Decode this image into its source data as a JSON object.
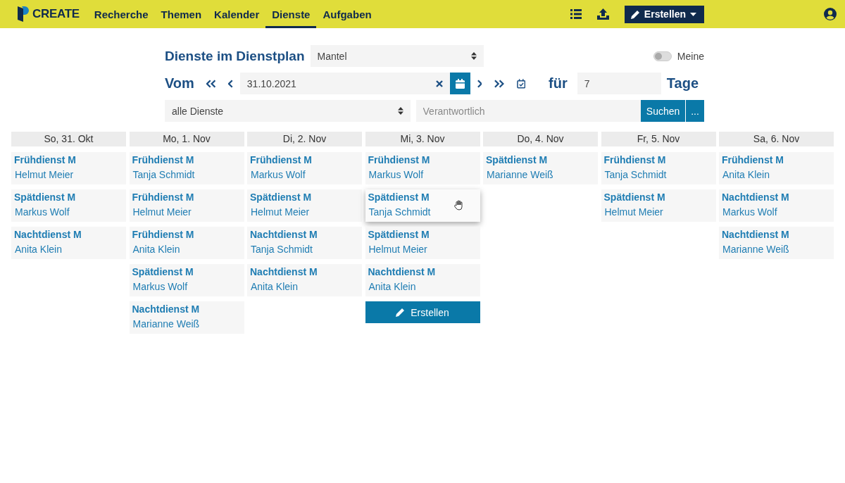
{
  "brand": "CREATE",
  "nav": [
    {
      "label": "Recherche",
      "selected": false
    },
    {
      "label": "Themen",
      "selected": false
    },
    {
      "label": "Kalender",
      "selected": false
    },
    {
      "label": "Dienste",
      "selected": true
    },
    {
      "label": "Aufgaben",
      "selected": false
    }
  ],
  "create_menu": "Erstellen",
  "filter": {
    "title": "Dienste im Dienstplan",
    "plan": "Mantel",
    "mine_label": "Meine",
    "mine_on": false,
    "from_label": "Vom",
    "date": "31.10.2021",
    "for_label": "für",
    "days": "7",
    "days_label": "Tage",
    "service": "alle Dienste",
    "responsible_placeholder": "Verantwortlich",
    "search": "Suchen",
    "more": "..."
  },
  "days": [
    {
      "header": "So, 31. Okt",
      "shifts": [
        {
          "name": "Frühdienst M",
          "person": "Helmut Meier",
          "hovered": false
        },
        {
          "name": "Spätdienst M",
          "person": "Markus Wolf",
          "hovered": false
        },
        {
          "name": "Nachtdienst M",
          "person": "Anita Klein",
          "hovered": false
        }
      ]
    },
    {
      "header": "Mo, 1. Nov",
      "shifts": [
        {
          "name": "Frühdienst M",
          "person": "Tanja Schmidt",
          "hovered": false
        },
        {
          "name": "Frühdienst M",
          "person": "Helmut Meier",
          "hovered": false
        },
        {
          "name": "Frühdienst M",
          "person": "Anita Klein",
          "hovered": false
        },
        {
          "name": "Spätdienst M",
          "person": "Markus Wolf",
          "hovered": false
        },
        {
          "name": "Nachtdienst M",
          "person": "Marianne Weiß",
          "hovered": false
        }
      ]
    },
    {
      "header": "Di, 2. Nov",
      "shifts": [
        {
          "name": "Frühdienst M",
          "person": "Markus Wolf",
          "hovered": false
        },
        {
          "name": "Spätdienst M",
          "person": "Helmut Meier",
          "hovered": false
        },
        {
          "name": "Nachtdienst M",
          "person": "Tanja Schmidt",
          "hovered": false
        },
        {
          "name": "Nachtdienst M",
          "person": "Anita Klein",
          "hovered": false
        }
      ]
    },
    {
      "header": "Mi, 3. Nov",
      "shifts": [
        {
          "name": "Frühdienst M",
          "person": "Markus Wolf",
          "hovered": false
        },
        {
          "name": "Spätdienst M",
          "person": "Tanja Schmidt",
          "hovered": true
        },
        {
          "name": "Spätdienst M",
          "person": "Helmut Meier",
          "hovered": false
        },
        {
          "name": "Nachtdienst M",
          "person": "Anita Klein",
          "hovered": false
        }
      ],
      "create_label": "Erstellen"
    },
    {
      "header": "Do, 4. Nov",
      "shifts": [
        {
          "name": "Spätdienst M",
          "person": "Marianne Weiß",
          "hovered": false
        }
      ]
    },
    {
      "header": "Fr, 5. Nov",
      "shifts": [
        {
          "name": "Frühdienst M",
          "person": "Tanja Schmidt",
          "hovered": false
        },
        {
          "name": "Spätdienst M",
          "person": "Helmut Meier",
          "hovered": false
        }
      ]
    },
    {
      "header": "Sa, 6. Nov",
      "shifts": [
        {
          "name": "Frühdienst M",
          "person": "Anita Klein",
          "hovered": false
        },
        {
          "name": "Nachtdienst M",
          "person": "Markus Wolf",
          "hovered": false
        },
        {
          "name": "Nachtdienst M",
          "person": "Marianne Weiß",
          "hovered": false
        }
      ]
    }
  ]
}
